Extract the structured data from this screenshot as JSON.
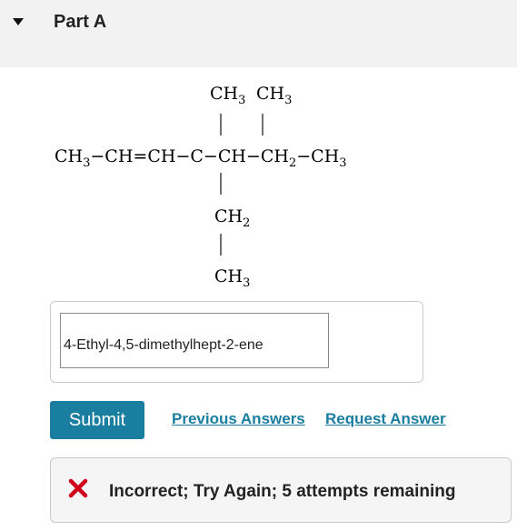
{
  "part": {
    "title": "Part A"
  },
  "molecule": {
    "top_branch_1": "CH",
    "top_branch_1_sub": "3",
    "top_branch_2": "CH",
    "top_branch_2_sub": "3",
    "main_chain": [
      {
        "text": "CH",
        "sub": "3"
      },
      {
        "text": "−CH=CH−C−CH−CH",
        "sub": ""
      },
      {
        "text": "",
        "sub": "2"
      },
      {
        "text": "−CH",
        "sub": "3"
      }
    ],
    "bottom_branch_1": "CH",
    "bottom_branch_1_sub": "2",
    "bottom_branch_2": "CH",
    "bottom_branch_2_sub": "3"
  },
  "answer": {
    "value": "4-Ethyl-4,5-dimethylhept-2-ene"
  },
  "actions": {
    "submit_label": "Submit",
    "previous_answers_label": "Previous Answers",
    "request_answer_label": "Request Answer"
  },
  "feedback": {
    "message": "Incorrect; Try Again; 5 attempts remaining",
    "color": "#d0021b"
  }
}
